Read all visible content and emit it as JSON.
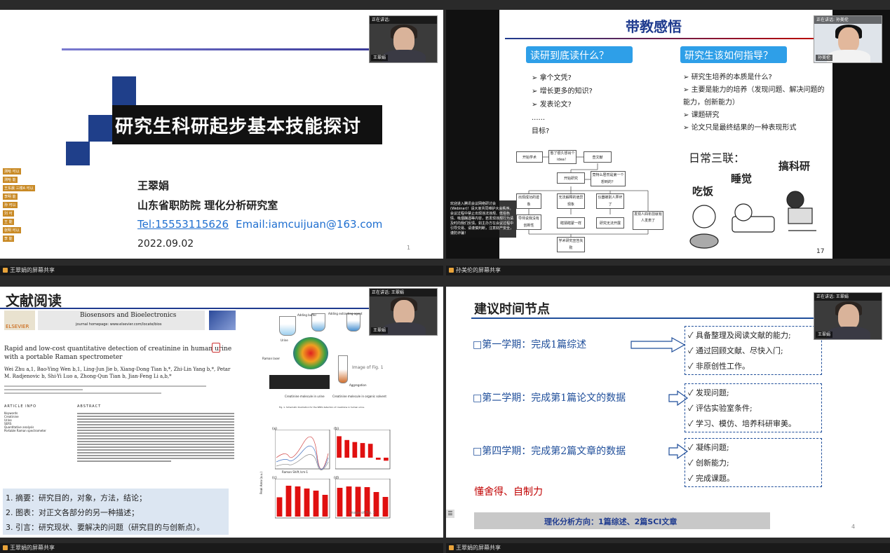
{
  "q1": {
    "title": "研究生科研起步基本技能探讨",
    "author": "王翠娟",
    "affiliation": "山东省职防院 理化分析研究室",
    "tel": "Tel:15553115626",
    "email": "Email:iamcuijuan@163.com",
    "date": "2022.09.02",
    "page": "1",
    "chat": [
      "测哈 可以",
      "测哈 能",
      "王东晨 三楼A 可以",
      "李明 能",
      "孙 可以",
      "刘 可",
      "王 能",
      "张明 可以",
      "李 能"
    ],
    "camera": {
      "header": "正在讲话:",
      "name": "王翠娟"
    },
    "share_label": "王翠娟的屏幕共享"
  },
  "q2": {
    "title": "带教感悟",
    "left_heading": "读研到底读什么？",
    "right_heading": "研究生该如何指导？",
    "left_items": [
      "拿个文凭?",
      "增长更多的知识?",
      "发表论文?",
      "......",
      "目标?"
    ],
    "right_items": [
      "研究生培养的本质是什么?",
      "主要是能力的培养（发现问题、解决问题的能力，创新能力）",
      "课题研究",
      "论文只是最终结果的一种表现形式"
    ],
    "flow_nodes": [
      "开始学术",
      "憋了很久想出个idea！",
      "查文献",
      "开始研究",
      "竟特么居然是第一个想到的？",
      "出现成功的迹象",
      "无法解释的诡异现象",
      "仪器被别人弄坏了",
      "导师说我没有创新性",
      "瞎猜瞎蒙一样",
      "研究无法开展",
      "发现人四年前就有人发表了",
      "学术研究宣告失败"
    ],
    "slogan": "日常三联：",
    "labels": [
      "吃饭",
      "睡觉",
      "搞科研"
    ],
    "notice": "欢迎进入腾讯会议网络研讨会(Webinar)！请大家共同维护大会秩序。会议过程中禁止出现违法违规、低俗色情、吸烟酗酒等内容，若发现违规行为请及时向我们反馈。如主办方在会议过程中引导交易、请谨慎判断，注意财产安全，谨防诈骗！",
    "page": "17",
    "camera": {
      "header": "正在讲话: 孙美伦",
      "name": "孙美伦"
    },
    "share_label": "孙美伦的屏幕共享"
  },
  "q3": {
    "title": "文献阅读",
    "journal": "Biosensors and Bioelectronics",
    "homepage": "journal homepage: www.elsevier.com/locate/bios",
    "publisher": "ELSEVIER",
    "paper_title_1": "Rapid and low-cost quantitative detection of creatinine in human urine",
    "paper_title_2": "with a portable Raman spectrometer",
    "authors_1": "Wei Zhu a,1, Bao-Ying Wen b,1, Ling-Jun Jie b, Xiang-Dong Tian b,*, Zhi-Lin Yang b,*, Petar",
    "authors_2": "M. Radjenovic b, Shi-Yi Luo a, Zhong-Qun Tian b, Jian-Feng Li a,b,*",
    "article_info": "ARTICLE INFO",
    "abstract_head": "ABSTRACT",
    "keywords": [
      "Keywords",
      "Creatinine",
      "Urine",
      "SERS",
      "Quantitative analysis",
      "Portable Raman spectrometer"
    ],
    "fig1_caption": "Fig. 1. Schematic illustration for the SERS detection of creatinine in human urine.",
    "fig1_labels": [
      "Adding buffer",
      "Adding extracting agent",
      "Urine",
      "Raman laser",
      "Image of Fig. 1",
      "Creatinine molecule in urine",
      "Creatinine molecule in organic solvent",
      "Aggregation"
    ],
    "panel_labels": [
      "(a)",
      "(b)",
      "(c)",
      "(d)"
    ],
    "fig2_labels": [
      "Raman Shift /cm-1",
      "Image of Fig. 2",
      "Peak Area (a.u.)"
    ],
    "summary": [
      "1. 摘要：研究目的，对象，方法，结论；",
      "2. 图表：对正文各部分的另一种描述；",
      "3. 引言：研究现状、要解决的问题（研究目的与创新点）。"
    ],
    "camera": {
      "header": "正在讲话: 王翠娟",
      "name": "王翠娟"
    },
    "share_label": "王翠娟的屏幕共享"
  },
  "q4": {
    "title": "建议时间节点",
    "terms": [
      {
        "label": "□第一学期：完成1篇综述",
        "items": [
          "具备整理及阅读文献的能力;",
          "通过回顾文献、尽快入门;",
          "非原创性工作。"
        ]
      },
      {
        "label": "□第二学期：完成第1篇论文的数据",
        "items": [
          "发现问题;",
          "评估实验室条件;",
          "学习、模仿、培养科研审美。"
        ]
      },
      {
        "label": "□第四学期：完成第2篇文章的数据",
        "items": [
          "凝练问题;",
          "创新能力;",
          "完成课题。"
        ]
      }
    ],
    "motto": "懂舍得、自制力",
    "footer": "理化分析方向：1篇综述、2篇SCI文章",
    "page": "4",
    "camera": {
      "header": "正在讲话: 王翠娟",
      "name": "王翠娟"
    },
    "share_label": "王翠娟的屏幕共享"
  },
  "chart_data": [
    {
      "type": "bar",
      "panel": "(b)",
      "values": [
        0.85,
        0.7,
        0.62,
        0.58,
        0.55,
        -0.08,
        -0.12
      ]
    },
    {
      "type": "bar",
      "panel": "(c)",
      "values": [
        0.55,
        0.88,
        0.86,
        0.8,
        0.74,
        0.62
      ]
    },
    {
      "type": "bar",
      "panel": "(d)",
      "values": [
        0.82,
        0.86,
        0.85,
        0.84,
        0.7,
        0.56
      ]
    }
  ],
  "colors": {
    "accent_blue": "#1f4e9a",
    "slide_title_red": "#c00000",
    "dark_slide_title": "#1f3b8f",
    "heading_box": "#2e9fe8",
    "chart_red": "#e01010"
  }
}
